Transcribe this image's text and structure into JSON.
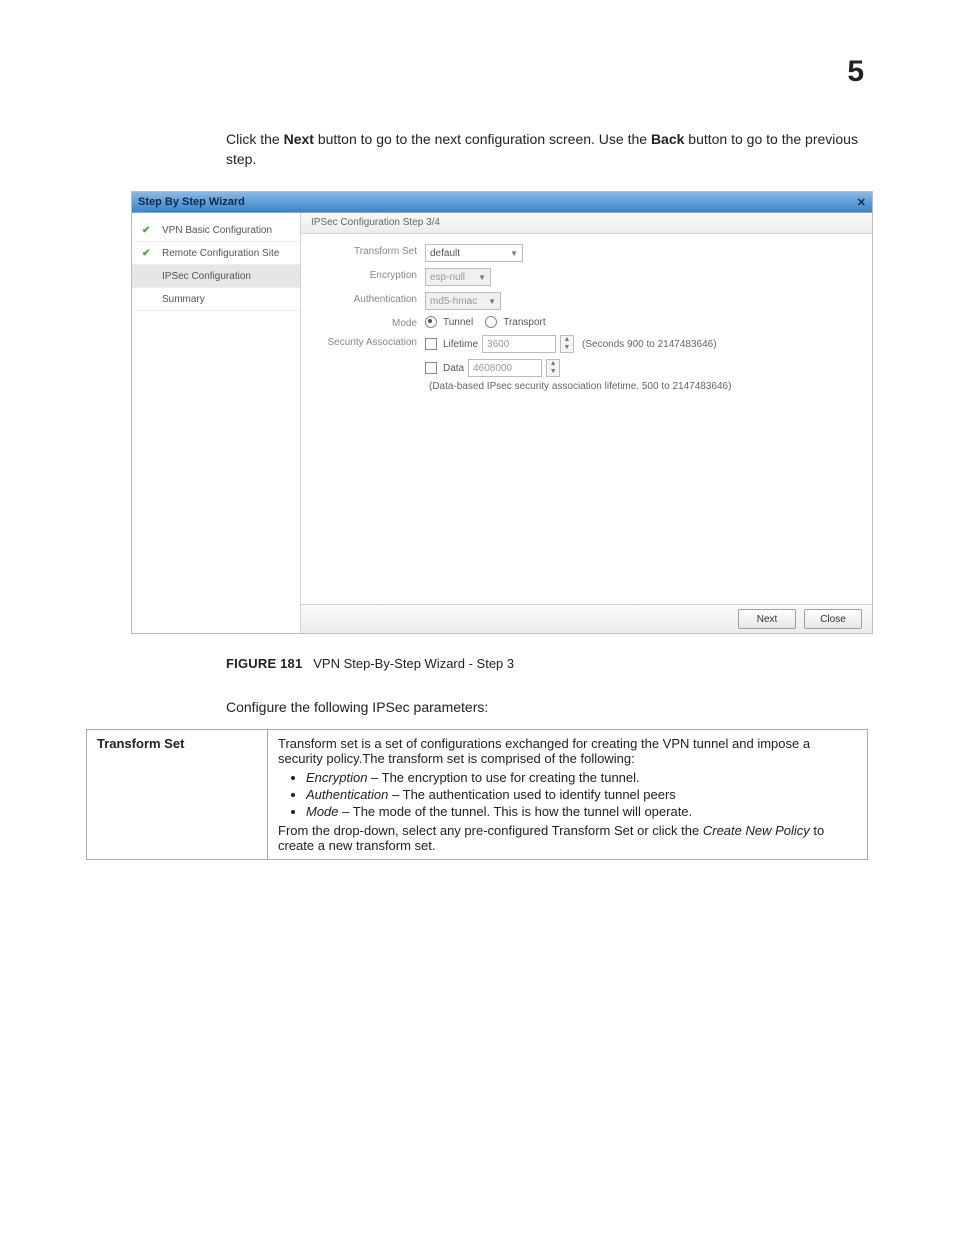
{
  "page_number": "5",
  "intro": {
    "pre1": "Click the ",
    "b1": "Next",
    "mid1": " button to go to the next configuration screen. Use the ",
    "b2": "Back",
    "post1": " button to go to the previous step."
  },
  "wizard": {
    "title": "Step By Step Wizard",
    "close_glyph": "✕",
    "sidebar": [
      {
        "label": "VPN Basic Configuration",
        "done": true,
        "active": false
      },
      {
        "label": "Remote Configuration Site",
        "done": true,
        "active": false
      },
      {
        "label": "IPSec Configuration",
        "done": false,
        "active": true
      },
      {
        "label": "Summary",
        "done": false,
        "active": false
      }
    ],
    "crumb": "IPSec Configuration  Step 3/4",
    "form": {
      "transform_set": {
        "label": "Transform Set",
        "value": "default"
      },
      "encryption": {
        "label": "Encryption",
        "value": "esp-null"
      },
      "authentication": {
        "label": "Authentication",
        "value": "md5-hmac"
      },
      "mode": {
        "label": "Mode",
        "opt1": "Tunnel",
        "opt2": "Transport"
      },
      "security_association": {
        "label": "Security Association",
        "lifetime_label": "Lifetime",
        "lifetime_value": "3600",
        "lifetime_hint": "(Seconds 900 to 2147483646)",
        "data_label": "Data",
        "data_value": "4608000",
        "data_hint": "(Data-based IPsec security association lifetime. 500 to 2147483646)"
      }
    },
    "footer": {
      "next": "Next",
      "close": "Close"
    }
  },
  "figure": {
    "label": "FIGURE 181",
    "caption": "VPN Step-By-Step Wizard - Step 3"
  },
  "configure_text": "Configure the following IPSec parameters:",
  "table": {
    "left": "Transform Set",
    "p1": "Transform set is a set of configurations exchanged for creating the VPN tunnel and impose a security policy.The transform set is comprised of the following:",
    "li1a": "Encryption",
    "li1b": " – The encryption to use for creating the tunnel.",
    "li2a": "Authentication",
    "li2b": " – The authentication used to identify tunnel peers",
    "li3a": "Mode",
    "li3b": " – The mode of the tunnel. This is how the tunnel will operate.",
    "p2a": "From the drop-down, select any pre-configured Transform Set or click the ",
    "p2b": "Create New Policy",
    "p2c": " to create a new transform set."
  }
}
